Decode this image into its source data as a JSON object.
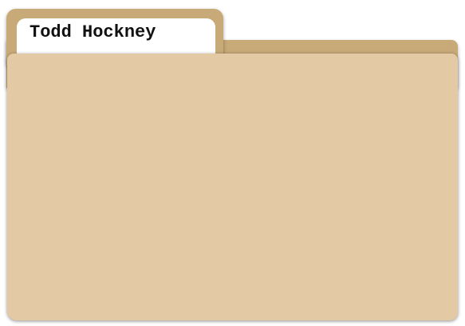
{
  "folder": {
    "tab_label": "Todd Hockney",
    "colors": {
      "front": "#e3caa4",
      "back": "#c7aa78",
      "label": "#ffffff",
      "label_text": "#111111"
    }
  }
}
